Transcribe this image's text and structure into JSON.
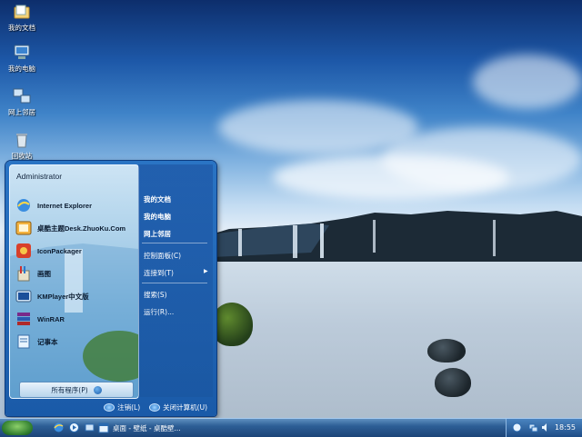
{
  "desktop": {
    "icons": [
      {
        "label": "我的文档",
        "icon": "folder-documents-icon"
      },
      {
        "label": "我的电脑",
        "icon": "computer-icon"
      },
      {
        "label": "网上邻居",
        "icon": "network-icon"
      },
      {
        "label": "回收站",
        "icon": "recycle-bin-icon"
      }
    ]
  },
  "start_menu": {
    "user_name": "Administrator",
    "programs": [
      {
        "label": "Internet Explorer",
        "icon": "internet-explorer-icon"
      },
      {
        "label": "桌酷主题Desk.ZhuoKu.Com",
        "icon": "zhuoku-icon"
      },
      {
        "label": "IconPackager",
        "icon": "iconpackager-icon"
      },
      {
        "label": "画图",
        "icon": "paint-icon"
      },
      {
        "label": "KMPlayer中文版",
        "icon": "kmplayer-icon"
      },
      {
        "label": "WinRAR",
        "icon": "winrar-icon"
      },
      {
        "label": "记事本",
        "icon": "notepad-icon"
      }
    ],
    "all_programs_label": "所有程序(P)",
    "right_items": [
      {
        "label": "我的文档",
        "bold": true
      },
      {
        "label": "我的电脑",
        "bold": true
      },
      {
        "label": "网上邻居",
        "bold": true
      },
      {
        "label": "控制面板(C)",
        "bold": false
      },
      {
        "label": "连接到(T)",
        "bold": false
      },
      {
        "label": "搜索(S)",
        "bold": false
      },
      {
        "label": "运行(R)...",
        "bold": false
      }
    ],
    "logoff_label": "注销(L)",
    "shutdown_label": "关闭计算机(U)"
  },
  "taskbar": {
    "task_label": "桌面 - 壁纸 - 桌酷壁...",
    "clock": "18:55"
  }
}
